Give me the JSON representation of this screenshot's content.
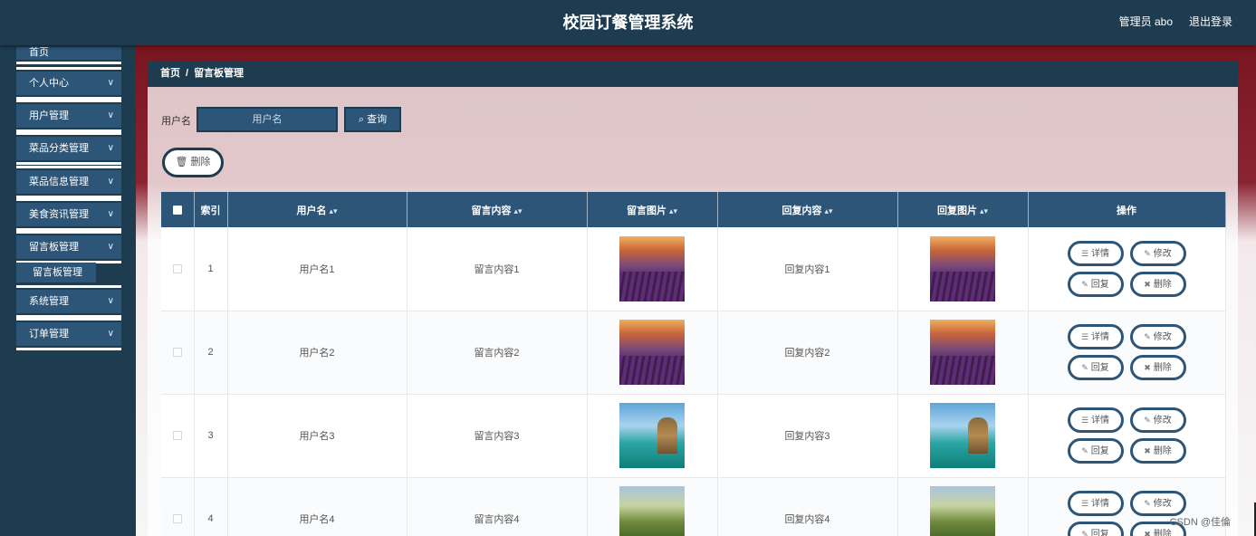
{
  "header": {
    "title": "校园订餐管理系统",
    "admin": "管理员 abo",
    "logout": "退出登录"
  },
  "sidebar": {
    "items": [
      {
        "label": "首页",
        "chevron": false
      },
      {
        "label": "个人中心",
        "chevron": true
      },
      {
        "label": "用户管理",
        "chevron": true
      },
      {
        "label": "菜品分类管理",
        "chevron": true
      },
      {
        "label": "菜品信息管理",
        "chevron": true
      },
      {
        "label": "美食资讯管理",
        "chevron": true
      },
      {
        "label": "留言板管理",
        "chevron": true,
        "submenu": [
          "留言板管理"
        ]
      },
      {
        "label": "系统管理",
        "chevron": true
      },
      {
        "label": "订单管理",
        "chevron": true
      }
    ]
  },
  "breadcrumb": {
    "home": "首页",
    "separator": "/",
    "current": "留言板管理"
  },
  "search": {
    "label": "用户名",
    "placeholder": "用户名",
    "button": "查询"
  },
  "toolbar": {
    "delete": "删除"
  },
  "table": {
    "headers": [
      "",
      "索引",
      "用户名",
      "留言内容",
      "留言图片",
      "回复内容",
      "回复图片",
      "操作"
    ],
    "sortable": [
      false,
      false,
      true,
      true,
      true,
      true,
      true,
      false
    ],
    "sort_icon": "⇕",
    "rows": [
      {
        "index": "1",
        "username": "用户名1",
        "content": "留言内容1",
        "image": "lavender",
        "reply": "回复内容1",
        "reply_image": "lavender"
      },
      {
        "index": "2",
        "username": "用户名2",
        "content": "留言内容2",
        "image": "lavender",
        "reply": "回复内容2",
        "reply_image": "lavender"
      },
      {
        "index": "3",
        "username": "用户名3",
        "content": "留言内容3",
        "image": "beach",
        "reply": "回复内容3",
        "reply_image": "beach"
      },
      {
        "index": "4",
        "username": "用户名4",
        "content": "留言内容4",
        "image": "trees",
        "reply": "回复内容4",
        "reply_image": "trees"
      }
    ],
    "actions": [
      {
        "label": "详情",
        "icon": "document-icon"
      },
      {
        "label": "修改",
        "icon": "pencil-icon"
      },
      {
        "label": "回复",
        "icon": "pencil-icon"
      },
      {
        "label": "删除",
        "icon": "trash-icon"
      }
    ]
  },
  "watermark": "CSDN @佳倫",
  "colors": {
    "primary": "#1e3c50",
    "accent": "#2c5578"
  }
}
